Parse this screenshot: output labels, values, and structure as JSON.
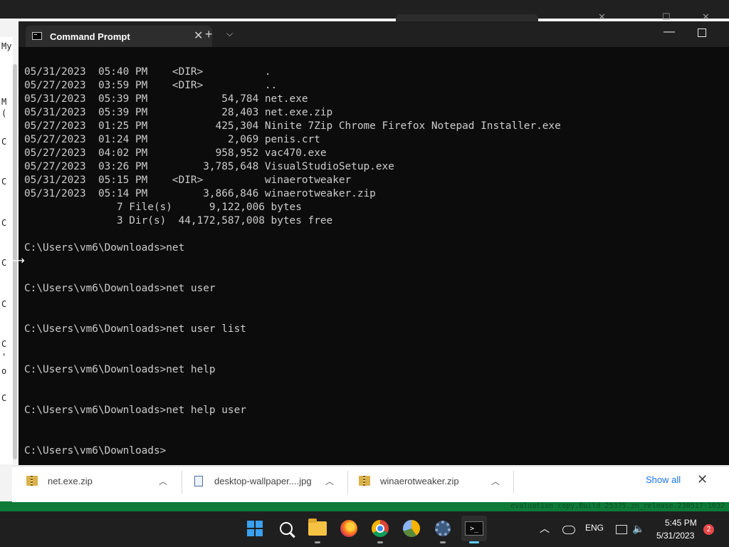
{
  "background": {
    "left_letters": [
      "My",
      "M",
      "(",
      "C",
      "C",
      "C",
      "C",
      "C",
      "C",
      "'",
      "o",
      "C"
    ],
    "strip_text": "evaluation copy.Build 25375.zn_release.230517-1032"
  },
  "terminal": {
    "tab_title": "Command Prompt",
    "lines": [
      "05/31/2023  05:40 PM    <DIR>          .",
      "05/27/2023  03:59 PM    <DIR>          ..",
      "05/31/2023  05:39 PM            54,784 net.exe",
      "05/31/2023  05:39 PM            28,403 net.exe.zip",
      "05/27/2023  01:25 PM           425,304 Ninite 7Zip Chrome Firefox Notepad Installer.exe",
      "05/27/2023  01:24 PM             2,069 penis.crt",
      "05/27/2023  04:02 PM           958,952 vac470.exe",
      "05/27/2023  03:26 PM         3,785,648 VisualStudioSetup.exe",
      "05/31/2023  05:15 PM    <DIR>          winaerotweaker",
      "05/31/2023  05:14 PM         3,866,846 winaerotweaker.zip",
      "               7 File(s)      9,122,006 bytes",
      "               3 Dir(s)  44,172,587,008 bytes free",
      "",
      "C:\\Users\\vm6\\Downloads>net",
      "",
      "",
      "C:\\Users\\vm6\\Downloads>net user",
      "",
      "",
      "C:\\Users\\vm6\\Downloads>net user list",
      "",
      "",
      "C:\\Users\\vm6\\Downloads>net help",
      "",
      "",
      "C:\\Users\\vm6\\Downloads>net help user",
      "",
      "",
      "C:\\Users\\vm6\\Downloads>"
    ]
  },
  "downloads": {
    "items": [
      {
        "name": "net.exe.zip",
        "icon": "zip-icon"
      },
      {
        "name": "desktop-wallpaper....jpg",
        "icon": "image-file-icon"
      },
      {
        "name": "winaerotweaker.zip",
        "icon": "zip-icon"
      }
    ],
    "show_all": "Show all"
  },
  "taskbar": {
    "language": "ENG",
    "time": "5:45 PM",
    "date": "5/31/2023",
    "notifications": "2"
  }
}
